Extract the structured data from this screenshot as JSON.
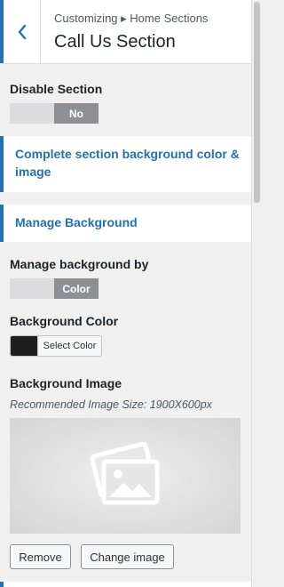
{
  "header": {
    "breadcrumb": "Customizing ▸ Home Sections",
    "title": "Call Us Section",
    "back_icon": "chevron-left-icon"
  },
  "disable_section": {
    "label": "Disable Section",
    "toggle_value": "No"
  },
  "links": {
    "complete_background": "Complete section background color & image",
    "manage_background": "Manage Background"
  },
  "manage_by": {
    "label": "Manage background by",
    "toggle_value": "Color"
  },
  "background_color": {
    "label": "Background Color",
    "button_label": "Select Color",
    "swatch_color": "#1f1f1f"
  },
  "background_image": {
    "label": "Background Image",
    "hint": "Recommended Image Size: 1900X600px",
    "placeholder_icon": "image-placeholder-icon",
    "remove_label": "Remove",
    "change_label": "Change image"
  },
  "colors": {
    "accent": "#2271b1",
    "panel_bg": "#f0f0f1",
    "toggle_active": "#8c8f94"
  }
}
